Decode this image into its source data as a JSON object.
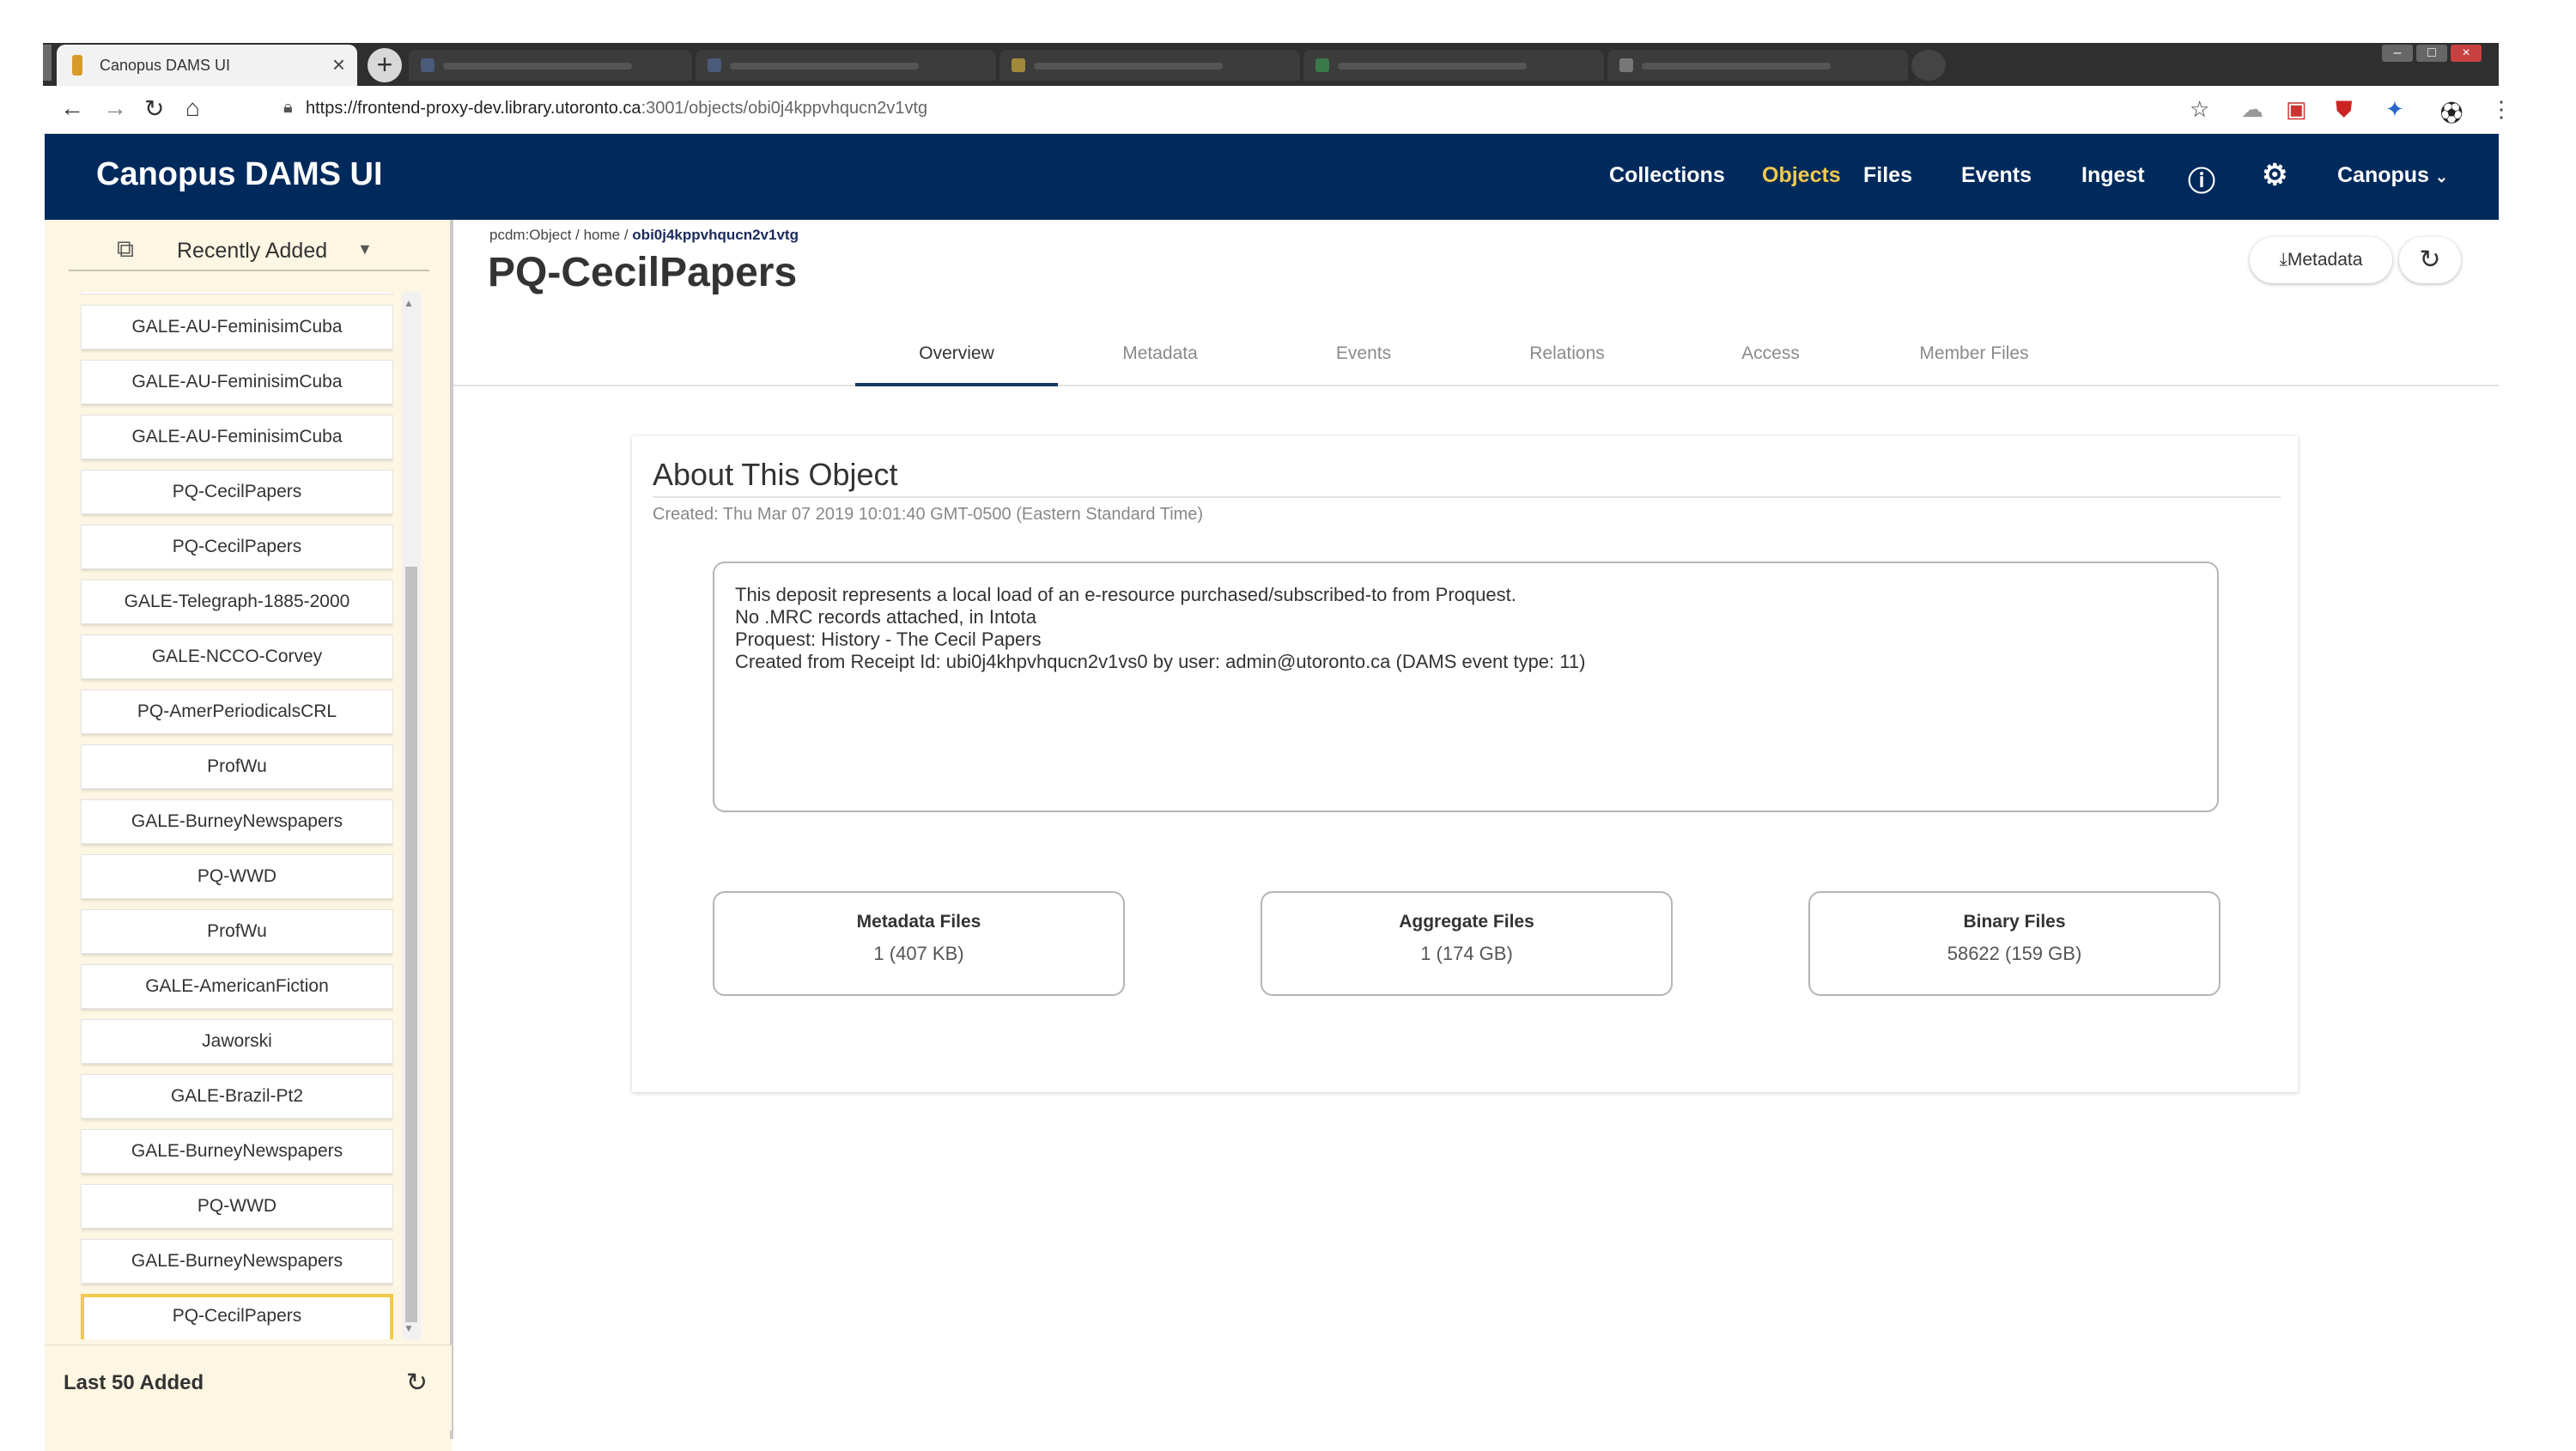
{
  "browser": {
    "tab_title": "Canopus DAMS UI",
    "tab_close": "×",
    "new_tab": "+",
    "url_host": "https://frontend-proxy-dev.library.utoronto.ca",
    "url_path": ":3001/objects/obi0j4kppvhqucn2v1vtg"
  },
  "header": {
    "brand": "Canopus DAMS UI",
    "nav": [
      "Collections",
      "Objects",
      "Files",
      "Events",
      "Ingest"
    ],
    "active_nav": "Objects",
    "user_menu": "Canopus"
  },
  "sidebar": {
    "sort_label": "Recently Added",
    "items": [
      "GALE-AU-FeminisimCuba",
      "GALE-AU-FeminisimCuba",
      "GALE-AU-FeminisimCuba",
      "PQ-CecilPapers",
      "PQ-CecilPapers",
      "GALE-Telegraph-1885-2000",
      "GALE-NCCO-Corvey",
      "PQ-AmerPeriodicalsCRL",
      "ProfWu",
      "GALE-BurneyNewspapers",
      "PQ-WWD",
      "ProfWu",
      "GALE-AmericanFiction",
      "Jaworski",
      "GALE-Brazil-Pt2",
      "GALE-BurneyNewspapers",
      "PQ-WWD",
      "GALE-BurneyNewspapers",
      "PQ-CecilPapers"
    ],
    "selected_index": 18,
    "footer_label": "Last 50 Added"
  },
  "main": {
    "breadcrumb_prefix": "pcdm:Object / home / ",
    "breadcrumb_current": "obi0j4kppvhqucn2v1vtg",
    "title": "PQ-CecilPapers",
    "metadata_button": "Metadata",
    "tabs": [
      "Overview",
      "Metadata",
      "Events",
      "Relations",
      "Access",
      "Member Files"
    ],
    "active_tab": "Overview"
  },
  "card": {
    "title": "About This Object",
    "created": "Created: Thu Mar 07 2019 10:01:40 GMT-0500 (Eastern Standard Time)",
    "description": [
      "This deposit represents a local load of an e-resource purchased/subscribed-to from Proquest.",
      "No .MRC records attached, in Intota",
      "Proquest: History - The Cecil Papers",
      "Created from Receipt Id: ubi0j4khpvhqucn2v1vs0 by user: admin@utoronto.ca (DAMS event type: 11)"
    ],
    "stats": [
      {
        "title": "Metadata Files",
        "value": "1 (407 KB)"
      },
      {
        "title": "Aggregate Files",
        "value": "1 (174 GB)"
      },
      {
        "title": "Binary Files",
        "value": "58622 (159 GB)"
      }
    ]
  },
  "colors": {
    "header_bg": "#002a5c",
    "active_nav": "#f2c94c",
    "sidebar_bg": "#fdf6e3",
    "selected_border": "#f2c94c"
  }
}
